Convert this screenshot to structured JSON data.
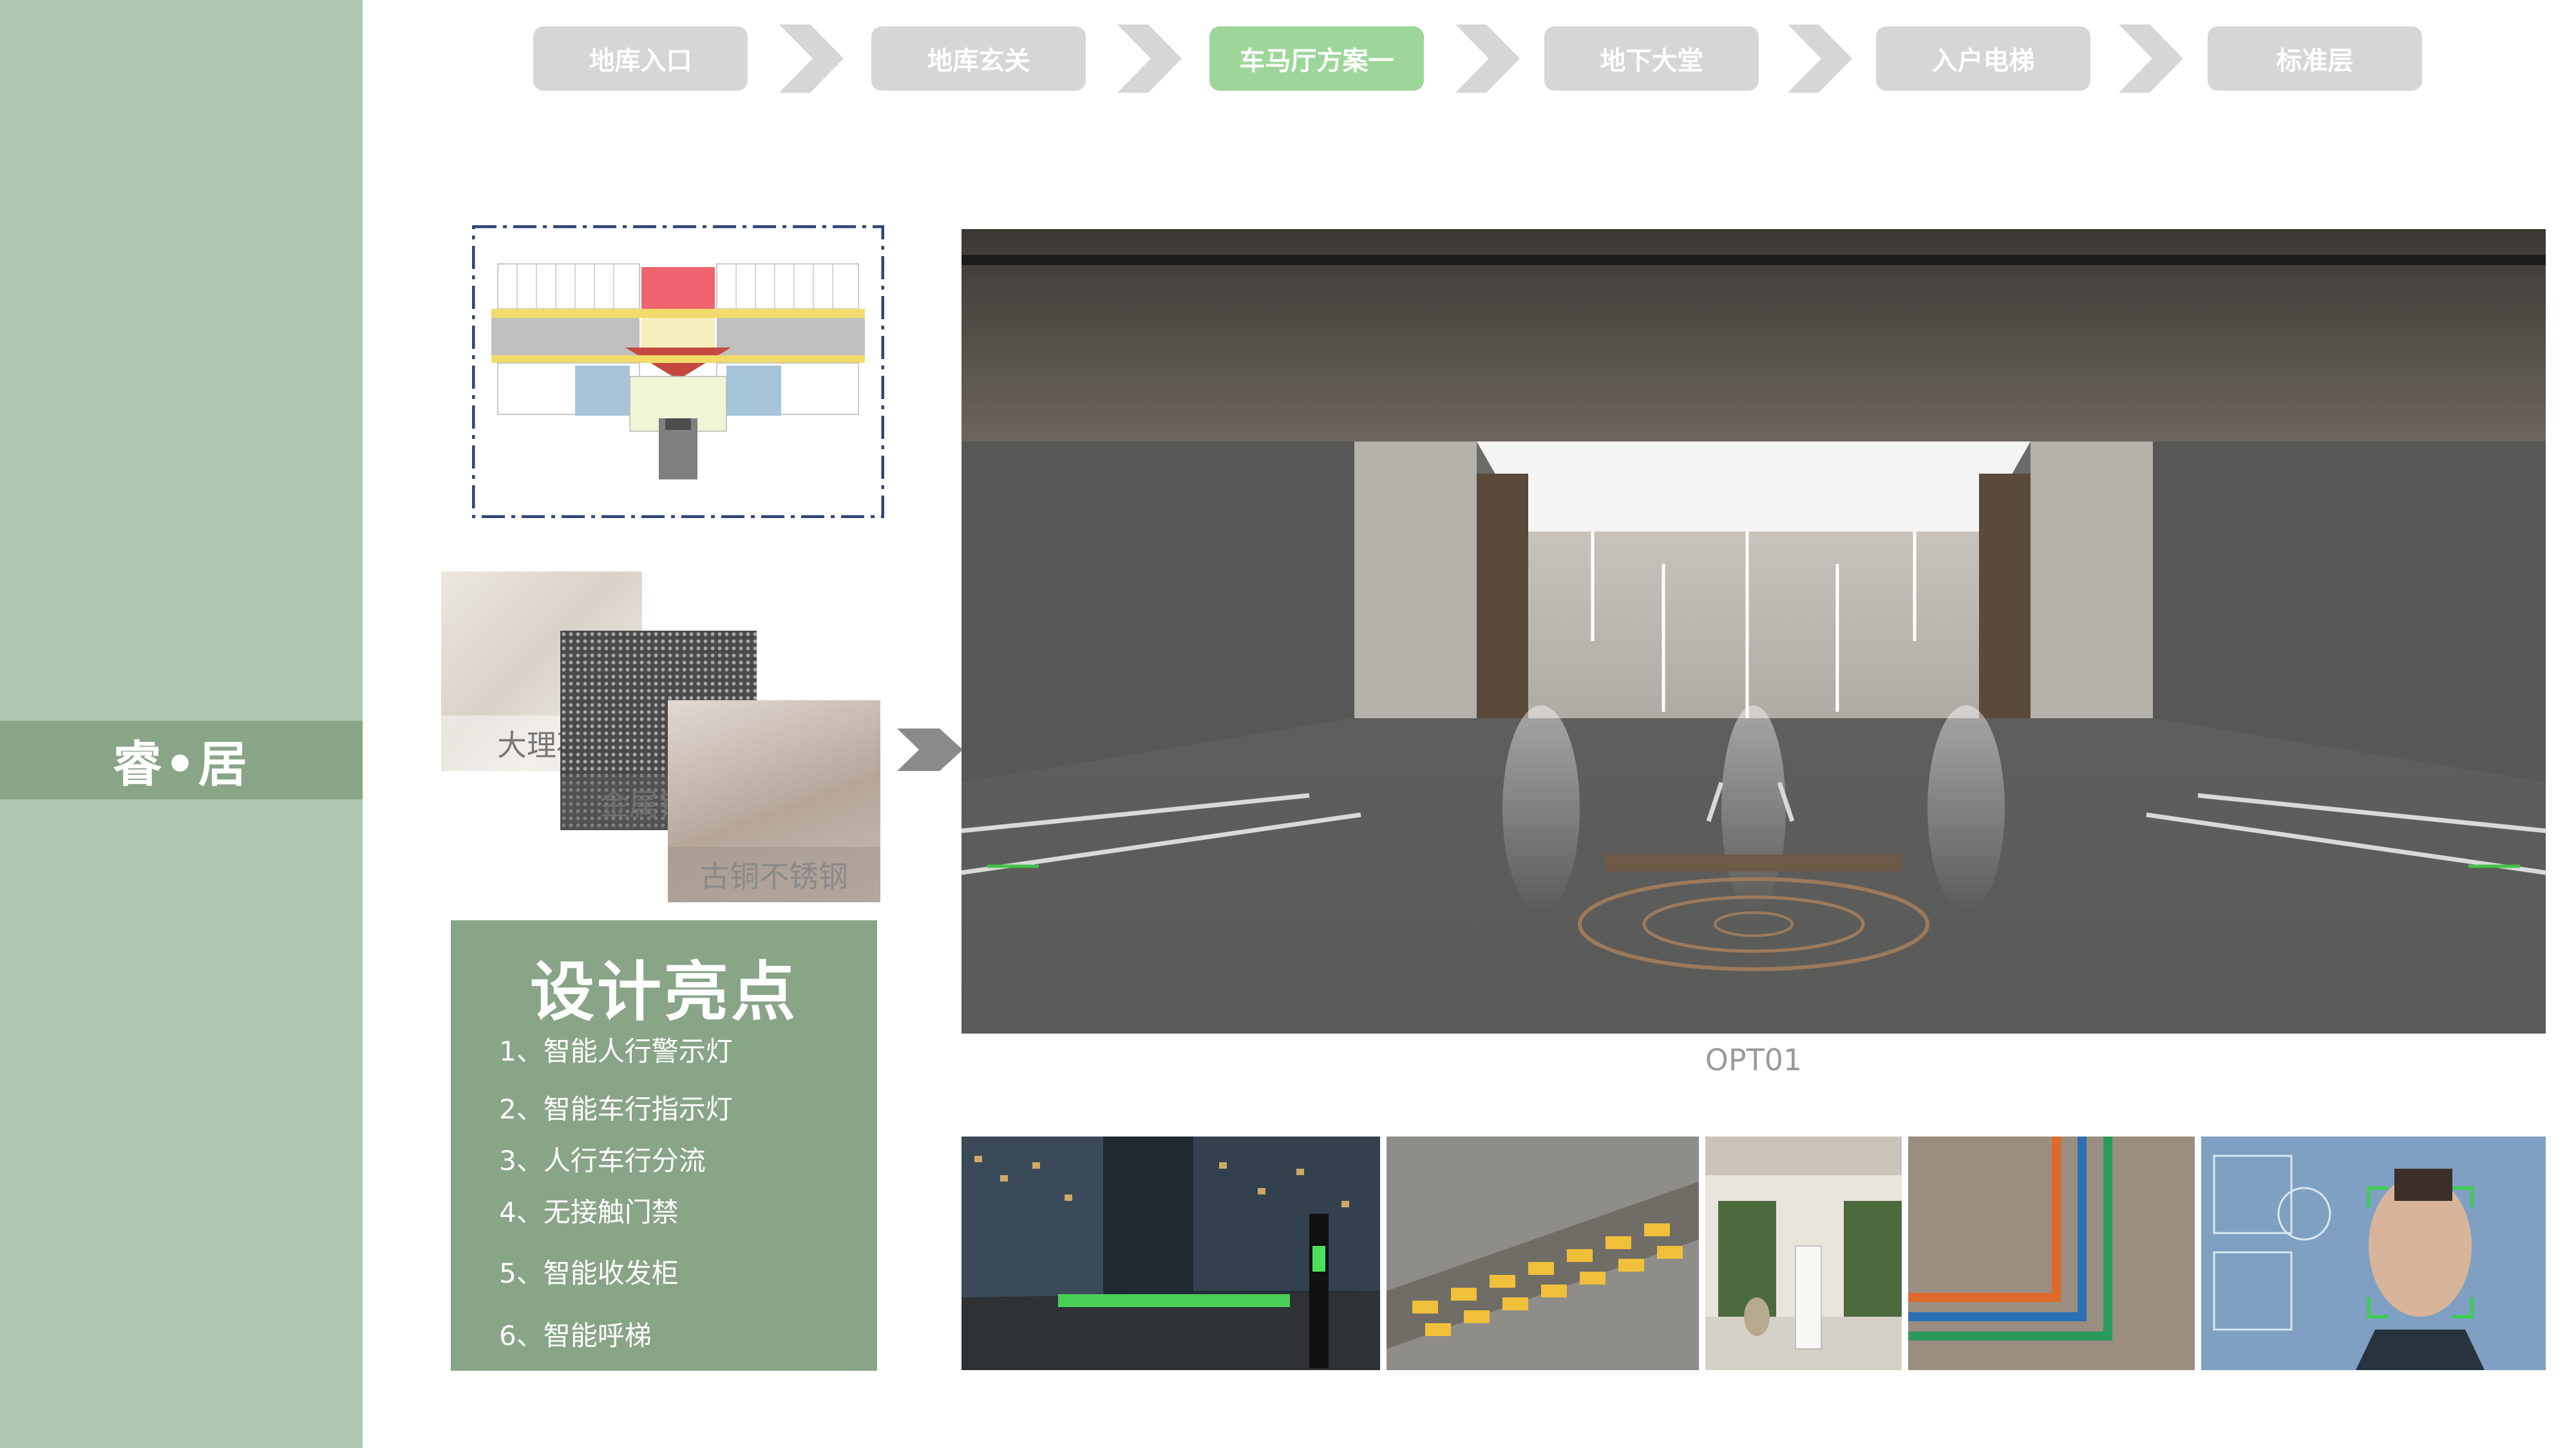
{
  "brand": {
    "title": "睿•居"
  },
  "nav": {
    "steps": [
      {
        "label": "地库入口",
        "active": false
      },
      {
        "label": "地库玄关",
        "active": false
      },
      {
        "label": "车马厅方案一",
        "active": true
      },
      {
        "label": "地下大堂",
        "active": false
      },
      {
        "label": "入户电梯",
        "active": false
      },
      {
        "label": "标准层",
        "active": false
      }
    ]
  },
  "materials": {
    "marble": "大理石",
    "perforated": "金属铝板",
    "bronze": "古铜不锈钢"
  },
  "highlights": {
    "title": "设计亮点",
    "items": [
      "1、智能人行警示灯",
      "2、智能车行指示灯",
      "3、人行车行分流",
      "4、无接触门禁",
      "5、智能收发柜",
      "6、智能呼梯"
    ]
  },
  "render": {
    "caption": "OPT01"
  },
  "colors": {
    "sidebar": "#afc6b1",
    "accent": "#88a587",
    "active_step": "#9ed69a",
    "inactive_step": "#d6d6d6"
  }
}
